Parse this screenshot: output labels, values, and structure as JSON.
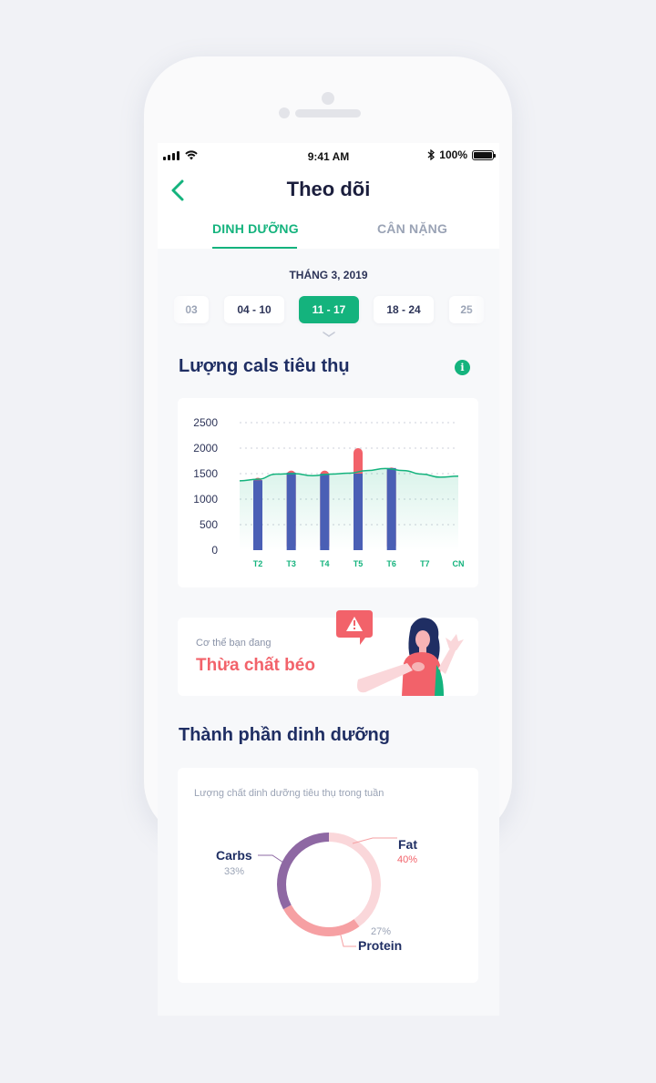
{
  "status_bar": {
    "time": "9:41 AM",
    "battery": "100%",
    "battery_level": 1.0
  },
  "header": {
    "title": "Theo dõi",
    "back_icon": "chevron-left-icon"
  },
  "tabs": [
    {
      "label": "DINH DƯỠNG",
      "active": true
    },
    {
      "label": "CÂN NẶNG",
      "active": false
    }
  ],
  "week_picker": {
    "month": "THÁNG 3, 2019",
    "weeks": [
      "03",
      "04 - 10",
      "11 - 17",
      "18 - 24",
      "25"
    ],
    "selected": "11 - 17"
  },
  "calories": {
    "title": "Lượng cals tiêu thụ",
    "info_icon": "info-icon"
  },
  "chart_data": {
    "type": "bar",
    "categories": [
      "T2",
      "T3",
      "T4",
      "T5",
      "T6",
      "T7",
      "CN"
    ],
    "y_ticks": [
      "2500",
      "2000",
      "1500",
      "1000",
      "500",
      "0"
    ],
    "ylim": [
      0,
      2500
    ],
    "series": [
      {
        "values": [
          1370,
          1520,
          1500,
          1500,
          1610,
          null,
          null
        ],
        "color": "#4a5fb5"
      },
      {
        "values": [
          1420,
          1560,
          1560,
          2000,
          1620,
          null,
          null
        ],
        "color": "#f2626a"
      }
    ],
    "trend": {
      "x": [
        0,
        0.5,
        1,
        1.5,
        2,
        2.5,
        3,
        3.5,
        4,
        4.5,
        5,
        5.5,
        6
      ],
      "y": [
        1360,
        1390,
        1490,
        1500,
        1460,
        1490,
        1510,
        1560,
        1600,
        1560,
        1490,
        1430,
        1450
      ],
      "color": "#14b37d"
    },
    "grid": true
  },
  "alert": {
    "label": "Cơ thể bạn đang",
    "value": "Thừa chất béo",
    "icon": "warning-icon"
  },
  "nutrition": {
    "title": "Thành phần dinh dưỡng",
    "subtitle": "Lượng chất dinh dưỡng tiêu thụ trong tuần",
    "slices": [
      {
        "name": "Fat",
        "percent": "40%",
        "value": 40,
        "color": "#fad7da"
      },
      {
        "name": "Protein",
        "percent": "27%",
        "value": 27,
        "color": "#f6a0a3"
      },
      {
        "name": "Carbs",
        "percent": "33%",
        "value": 33,
        "color": "#8e68a3"
      }
    ]
  },
  "colors": {
    "accent": "#14b37d",
    "navy": "#1f2e63",
    "danger": "#f2626a"
  }
}
